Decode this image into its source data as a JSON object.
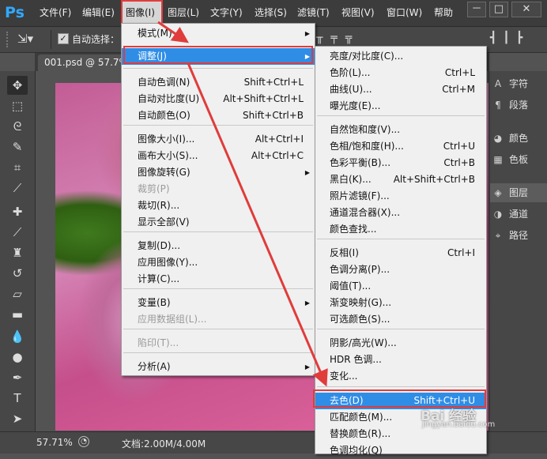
{
  "app": {
    "logo": "Ps",
    "menubar": [
      "文件(F)",
      "编辑(E)",
      "图像(I)",
      "图层(L)",
      "文字(Y)",
      "选择(S)",
      "滤镜(T)",
      "视图(V)",
      "窗口(W)",
      "帮助"
    ],
    "window_controls": [
      "－",
      "□",
      "✕"
    ]
  },
  "options_bar": {
    "auto_select_label": "自动选择："
  },
  "document_tab": {
    "title": "001.psd @ 57.7%"
  },
  "status": {
    "zoom": "57.71%",
    "doc_info": "文档:2.00M/4.00M"
  },
  "right_panel": {
    "items": [
      {
        "icon": "A",
        "label": "字符"
      },
      {
        "icon": "¶",
        "label": "段落"
      },
      {
        "icon": "◕",
        "label": "颜色"
      },
      {
        "icon": "▦",
        "label": "色板"
      },
      {
        "icon": "◈",
        "label": "图层"
      },
      {
        "icon": "◑",
        "label": "通道"
      },
      {
        "icon": "⌖",
        "label": "路径"
      }
    ]
  },
  "image_menu": {
    "items": [
      {
        "label": "模式(M)",
        "shortcut": "",
        "submenu": true
      },
      {
        "label": "调整(J)",
        "shortcut": "",
        "submenu": true,
        "highlighted": true
      },
      {
        "label": "自动色调(N)",
        "shortcut": "Shift+Ctrl+L"
      },
      {
        "label": "自动对比度(U)",
        "shortcut": "Alt+Shift+Ctrl+L"
      },
      {
        "label": "自动颜色(O)",
        "shortcut": "Shift+Ctrl+B"
      },
      {
        "label": "图像大小(I)...",
        "shortcut": "Alt+Ctrl+I"
      },
      {
        "label": "画布大小(S)...",
        "shortcut": "Alt+Ctrl+C"
      },
      {
        "label": "图像旋转(G)",
        "shortcut": "",
        "submenu": true
      },
      {
        "label": "裁剪(P)",
        "shortcut": "",
        "disabled": true
      },
      {
        "label": "裁切(R)...",
        "shortcut": ""
      },
      {
        "label": "显示全部(V)",
        "shortcut": ""
      },
      {
        "label": "复制(D)...",
        "shortcut": ""
      },
      {
        "label": "应用图像(Y)...",
        "shortcut": ""
      },
      {
        "label": "计算(C)...",
        "shortcut": ""
      },
      {
        "label": "变量(B)",
        "shortcut": "",
        "submenu": true
      },
      {
        "label": "应用数据组(L)...",
        "shortcut": "",
        "disabled": true
      },
      {
        "label": "陷印(T)...",
        "shortcut": "",
        "disabled": true
      },
      {
        "label": "分析(A)",
        "shortcut": "",
        "submenu": true
      }
    ]
  },
  "adjust_menu": {
    "items": [
      {
        "label": "亮度/对比度(C)...",
        "shortcut": ""
      },
      {
        "label": "色阶(L)...",
        "shortcut": "Ctrl+L"
      },
      {
        "label": "曲线(U)...",
        "shortcut": "Ctrl+M"
      },
      {
        "label": "曝光度(E)...",
        "shortcut": ""
      },
      {
        "label": "自然饱和度(V)...",
        "shortcut": ""
      },
      {
        "label": "色相/饱和度(H)...",
        "shortcut": "Ctrl+U"
      },
      {
        "label": "色彩平衡(B)...",
        "shortcut": "Ctrl+B"
      },
      {
        "label": "黑白(K)...",
        "shortcut": "Alt+Shift+Ctrl+B"
      },
      {
        "label": "照片滤镜(F)...",
        "shortcut": ""
      },
      {
        "label": "通道混合器(X)...",
        "shortcut": ""
      },
      {
        "label": "颜色查找...",
        "shortcut": ""
      },
      {
        "label": "反相(I)",
        "shortcut": "Ctrl+I"
      },
      {
        "label": "色调分离(P)...",
        "shortcut": ""
      },
      {
        "label": "阈值(T)...",
        "shortcut": ""
      },
      {
        "label": "渐变映射(G)...",
        "shortcut": ""
      },
      {
        "label": "可选颜色(S)...",
        "shortcut": ""
      },
      {
        "label": "阴影/高光(W)...",
        "shortcut": ""
      },
      {
        "label": "HDR 色调...",
        "shortcut": ""
      },
      {
        "label": "变化...",
        "shortcut": ""
      },
      {
        "label": "去色(D)",
        "shortcut": "Shift+Ctrl+U",
        "highlighted": true
      },
      {
        "label": "匹配颜色(M)...",
        "shortcut": ""
      },
      {
        "label": "替换颜色(R)...",
        "shortcut": ""
      },
      {
        "label": "色调均化(Q)",
        "shortcut": ""
      }
    ]
  },
  "watermark": {
    "text": "Bai 经验",
    "url": "jingyan.baidu.com"
  },
  "colors": {
    "highlight": "#2f8de6",
    "annotation_red": "#e03c3c"
  }
}
